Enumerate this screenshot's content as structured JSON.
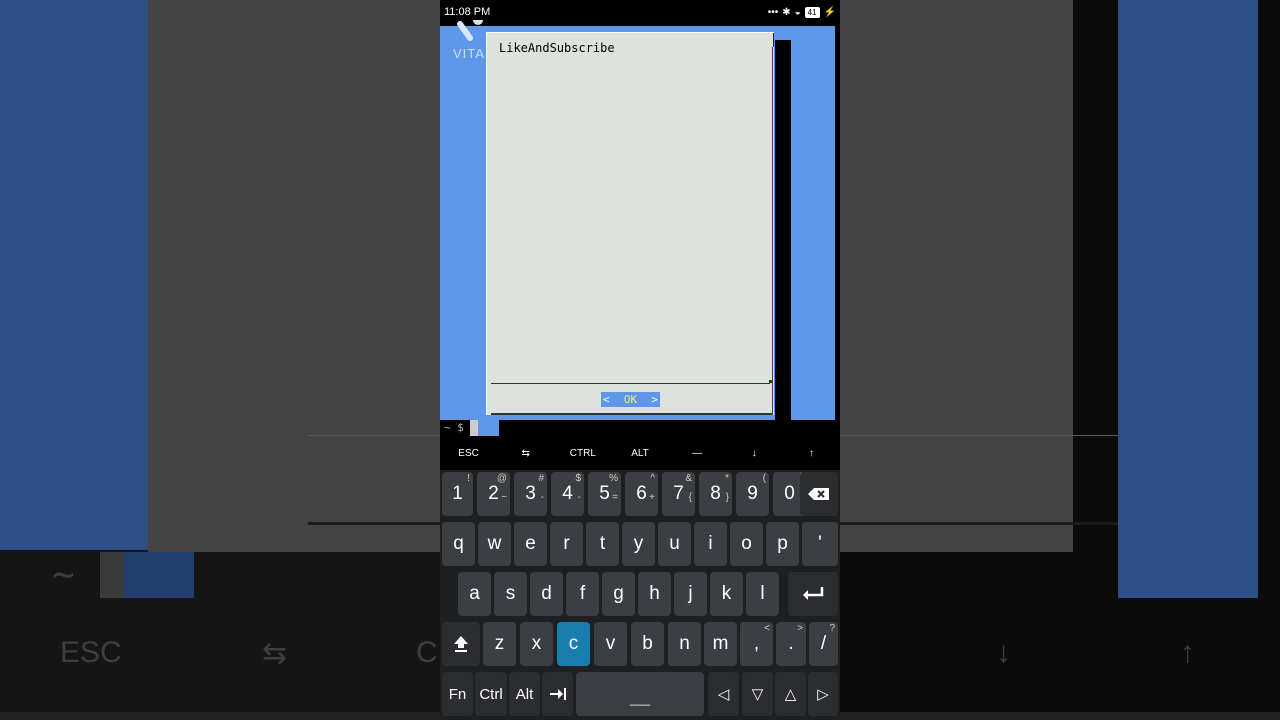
{
  "status_bar": {
    "time": "11:08 PM",
    "icons": [
      "more-icon",
      "bluetooth-icon",
      "wifi-icon"
    ],
    "battery": "41"
  },
  "terminal": {
    "logo_text": "VITA",
    "dialog": {
      "message": "LikeAndSubscribe",
      "ok_left": "<",
      "ok_label": "OK",
      "ok_right": ">"
    },
    "prompt": "~ $"
  },
  "extra_keys": [
    "ESC",
    "⇆",
    "CTRL",
    "ALT",
    "—",
    "↓",
    "↑"
  ],
  "keyboard": {
    "row1": [
      {
        "k": "1",
        "s": "!"
      },
      {
        "k": "2",
        "s": "@",
        "s2": "~"
      },
      {
        "k": "3",
        "s": "#",
        "s2": "-"
      },
      {
        "k": "4",
        "s": "$",
        "s2": "-"
      },
      {
        "k": "5",
        "s": "%",
        "s2": "="
      },
      {
        "k": "6",
        "s": "^",
        "s2": "+"
      },
      {
        "k": "7",
        "s": "&",
        "s2": "{"
      },
      {
        "k": "8",
        "s": "*",
        "s2": "}"
      },
      {
        "k": "9",
        "s": "(",
        "s2": ""
      },
      {
        "k": "0",
        "s": ")",
        "s2": ""
      }
    ],
    "row2": [
      "q",
      "w",
      "e",
      "r",
      "t",
      "y",
      "u",
      "i",
      "o",
      "p",
      "'"
    ],
    "row3": [
      "a",
      "s",
      "d",
      "f",
      "g",
      "h",
      "j",
      "k",
      "l"
    ],
    "row4": [
      "z",
      "x",
      "c",
      "v",
      "b",
      "n",
      "m",
      ",",
      ".",
      "/"
    ],
    "row4_subs": {
      "comma": "<",
      "dot": ">",
      "slash": "?"
    },
    "row5": [
      "Fn",
      "Ctrl",
      "Alt"
    ],
    "space_label": "___",
    "arrows": [
      "◁",
      "▽",
      "△",
      "▷"
    ],
    "active_key": "c"
  },
  "background": {
    "prompt": "~ $",
    "labels": [
      "ESC",
      "⇆",
      "C",
      "↓",
      "↑"
    ]
  },
  "colors": {
    "terminal_blue": "#5f97e8",
    "dialog_bg": "#dde3dc",
    "ok_text": "#f5f35a",
    "key_active": "#197db0"
  }
}
